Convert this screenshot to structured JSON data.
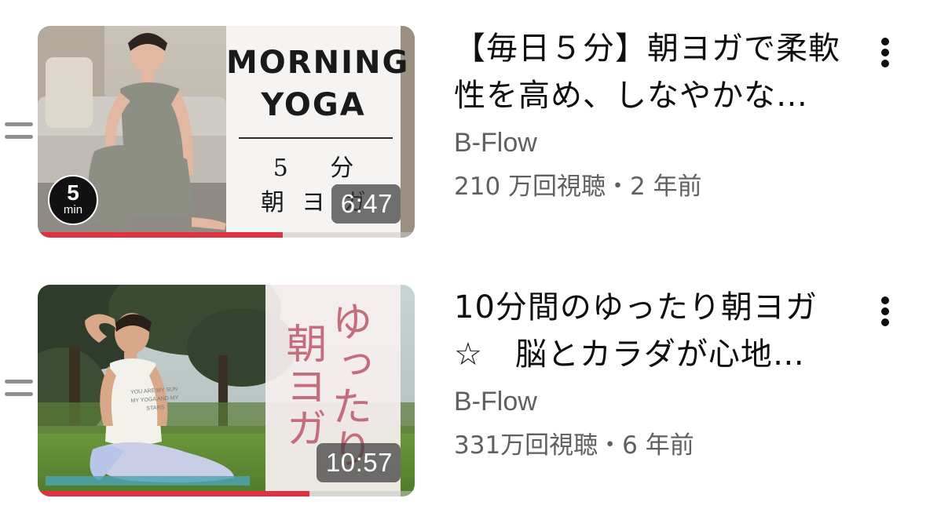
{
  "videos": [
    {
      "title_line1": "【毎日５分】朝ヨガで柔軟",
      "title_line2": "性を高め、しなやかな…",
      "channel": "B-Flow",
      "stats": "210 万回視聴・2 年前",
      "duration": "6:47",
      "progress": 0.65,
      "thumb_title_line1": "MORNING",
      "thumb_title_line2": "YOGA",
      "thumb_sub_line1": "5 分",
      "thumb_sub_line2": "朝ヨガ",
      "badge_number": "5",
      "badge_unit": "min"
    },
    {
      "title_line1": "10分間のゆったり朝ヨガ",
      "title_line2": "☆　脳とカラダが心地…",
      "channel": "B-Flow",
      "stats": "331万回視聴・6 年前",
      "duration": "10:57",
      "progress": 0.72,
      "thumb_text_a": "ゆったり",
      "thumb_text_b": "朝ヨガ",
      "shirt_text": "YOU ARE MY SUN MY YOGA AND MY STARS"
    }
  ],
  "colors": {
    "progress": "#e03142",
    "thumb_text_pink": "#c56d7c"
  },
  "icons": {
    "drag": "drag-handle-icon",
    "more": "more-vertical-icon"
  }
}
